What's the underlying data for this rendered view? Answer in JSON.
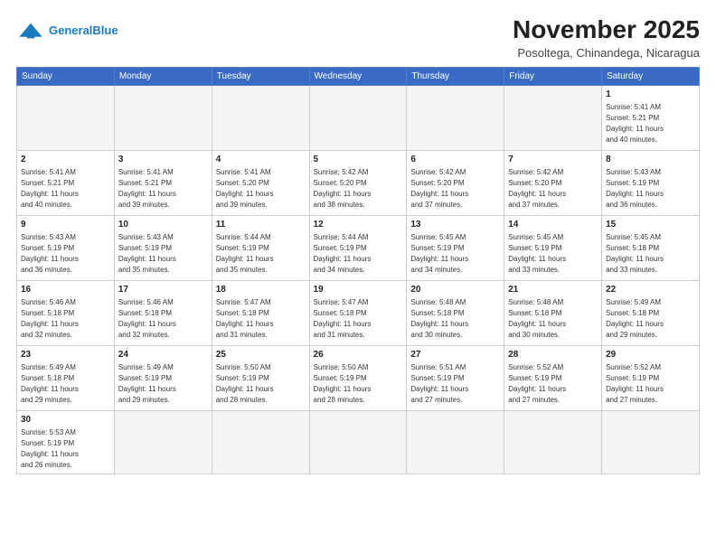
{
  "header": {
    "logo_general": "General",
    "logo_blue": "Blue",
    "month_title": "November 2025",
    "location": "Posoltega, Chinandega, Nicaragua"
  },
  "weekdays": [
    "Sunday",
    "Monday",
    "Tuesday",
    "Wednesday",
    "Thursday",
    "Friday",
    "Saturday"
  ],
  "weeks": [
    [
      {
        "day": null,
        "info": null
      },
      {
        "day": null,
        "info": null
      },
      {
        "day": null,
        "info": null
      },
      {
        "day": null,
        "info": null
      },
      {
        "day": null,
        "info": null
      },
      {
        "day": null,
        "info": null
      },
      {
        "day": "1",
        "info": "Sunrise: 5:41 AM\nSunset: 5:21 PM\nDaylight: 11 hours\nand 40 minutes."
      }
    ],
    [
      {
        "day": "2",
        "info": "Sunrise: 5:41 AM\nSunset: 5:21 PM\nDaylight: 11 hours\nand 40 minutes."
      },
      {
        "day": "3",
        "info": "Sunrise: 5:41 AM\nSunset: 5:21 PM\nDaylight: 11 hours\nand 39 minutes."
      },
      {
        "day": "4",
        "info": "Sunrise: 5:41 AM\nSunset: 5:20 PM\nDaylight: 11 hours\nand 39 minutes."
      },
      {
        "day": "5",
        "info": "Sunrise: 5:42 AM\nSunset: 5:20 PM\nDaylight: 11 hours\nand 38 minutes."
      },
      {
        "day": "6",
        "info": "Sunrise: 5:42 AM\nSunset: 5:20 PM\nDaylight: 11 hours\nand 37 minutes."
      },
      {
        "day": "7",
        "info": "Sunrise: 5:42 AM\nSunset: 5:20 PM\nDaylight: 11 hours\nand 37 minutes."
      },
      {
        "day": "8",
        "info": "Sunrise: 5:43 AM\nSunset: 5:19 PM\nDaylight: 11 hours\nand 36 minutes."
      }
    ],
    [
      {
        "day": "9",
        "info": "Sunrise: 5:43 AM\nSunset: 5:19 PM\nDaylight: 11 hours\nand 36 minutes."
      },
      {
        "day": "10",
        "info": "Sunrise: 5:43 AM\nSunset: 5:19 PM\nDaylight: 11 hours\nand 35 minutes."
      },
      {
        "day": "11",
        "info": "Sunrise: 5:44 AM\nSunset: 5:19 PM\nDaylight: 11 hours\nand 35 minutes."
      },
      {
        "day": "12",
        "info": "Sunrise: 5:44 AM\nSunset: 5:19 PM\nDaylight: 11 hours\nand 34 minutes."
      },
      {
        "day": "13",
        "info": "Sunrise: 5:45 AM\nSunset: 5:19 PM\nDaylight: 11 hours\nand 34 minutes."
      },
      {
        "day": "14",
        "info": "Sunrise: 5:45 AM\nSunset: 5:19 PM\nDaylight: 11 hours\nand 33 minutes."
      },
      {
        "day": "15",
        "info": "Sunrise: 5:45 AM\nSunset: 5:18 PM\nDaylight: 11 hours\nand 33 minutes."
      }
    ],
    [
      {
        "day": "16",
        "info": "Sunrise: 5:46 AM\nSunset: 5:18 PM\nDaylight: 11 hours\nand 32 minutes."
      },
      {
        "day": "17",
        "info": "Sunrise: 5:46 AM\nSunset: 5:18 PM\nDaylight: 11 hours\nand 32 minutes."
      },
      {
        "day": "18",
        "info": "Sunrise: 5:47 AM\nSunset: 5:18 PM\nDaylight: 11 hours\nand 31 minutes."
      },
      {
        "day": "19",
        "info": "Sunrise: 5:47 AM\nSunset: 5:18 PM\nDaylight: 11 hours\nand 31 minutes."
      },
      {
        "day": "20",
        "info": "Sunrise: 5:48 AM\nSunset: 5:18 PM\nDaylight: 11 hours\nand 30 minutes."
      },
      {
        "day": "21",
        "info": "Sunrise: 5:48 AM\nSunset: 5:18 PM\nDaylight: 11 hours\nand 30 minutes."
      },
      {
        "day": "22",
        "info": "Sunrise: 5:49 AM\nSunset: 5:18 PM\nDaylight: 11 hours\nand 29 minutes."
      }
    ],
    [
      {
        "day": "23",
        "info": "Sunrise: 5:49 AM\nSunset: 5:18 PM\nDaylight: 11 hours\nand 29 minutes."
      },
      {
        "day": "24",
        "info": "Sunrise: 5:49 AM\nSunset: 5:19 PM\nDaylight: 11 hours\nand 29 minutes."
      },
      {
        "day": "25",
        "info": "Sunrise: 5:50 AM\nSunset: 5:19 PM\nDaylight: 11 hours\nand 28 minutes."
      },
      {
        "day": "26",
        "info": "Sunrise: 5:50 AM\nSunset: 5:19 PM\nDaylight: 11 hours\nand 28 minutes."
      },
      {
        "day": "27",
        "info": "Sunrise: 5:51 AM\nSunset: 5:19 PM\nDaylight: 11 hours\nand 27 minutes."
      },
      {
        "day": "28",
        "info": "Sunrise: 5:52 AM\nSunset: 5:19 PM\nDaylight: 11 hours\nand 27 minutes."
      },
      {
        "day": "29",
        "info": "Sunrise: 5:52 AM\nSunset: 5:19 PM\nDaylight: 11 hours\nand 27 minutes."
      }
    ],
    [
      {
        "day": "30",
        "info": "Sunrise: 5:53 AM\nSunset: 5:19 PM\nDaylight: 11 hours\nand 26 minutes."
      },
      {
        "day": null,
        "info": null
      },
      {
        "day": null,
        "info": null
      },
      {
        "day": null,
        "info": null
      },
      {
        "day": null,
        "info": null
      },
      {
        "day": null,
        "info": null
      },
      {
        "day": null,
        "info": null
      }
    ]
  ]
}
